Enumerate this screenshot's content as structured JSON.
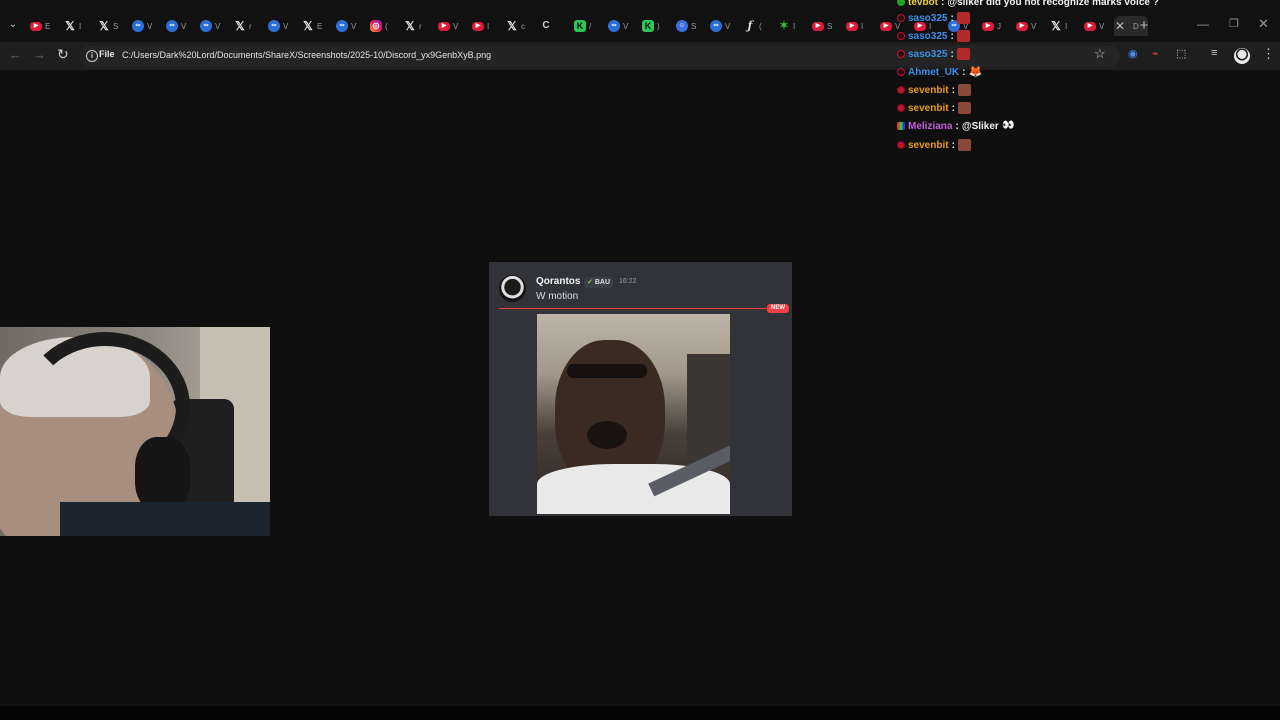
{
  "browser": {
    "tabs": [
      {
        "icon": "youtube-icon",
        "glyph": "▶",
        "kind": "yt",
        "label": "E"
      },
      {
        "icon": "x-icon",
        "glyph": "𝕏",
        "kind": "x",
        "label": "I"
      },
      {
        "icon": "x-icon",
        "glyph": "𝕏",
        "kind": "x",
        "label": "S"
      },
      {
        "icon": "copilot-icon",
        "glyph": "∞",
        "kind": "cp",
        "label": "V"
      },
      {
        "icon": "copilot-icon",
        "glyph": "∞",
        "kind": "cp",
        "label": "V"
      },
      {
        "icon": "copilot-icon",
        "glyph": "∞",
        "kind": "cp",
        "label": "V"
      },
      {
        "icon": "x-icon",
        "glyph": "𝕏",
        "kind": "x",
        "label": "r"
      },
      {
        "icon": "copilot-icon",
        "glyph": "∞",
        "kind": "cp",
        "label": "V"
      },
      {
        "icon": "x-icon",
        "glyph": "𝕏",
        "kind": "x",
        "label": "E"
      },
      {
        "icon": "copilot-icon",
        "glyph": "∞",
        "kind": "cp",
        "label": "V"
      },
      {
        "icon": "instagram-icon",
        "glyph": "◎",
        "kind": "ig",
        "label": "("
      },
      {
        "icon": "x-icon",
        "glyph": "𝕏",
        "kind": "x",
        "label": "r"
      },
      {
        "icon": "youtube-icon",
        "glyph": "▶",
        "kind": "yt",
        "label": "V"
      },
      {
        "icon": "youtube-icon",
        "glyph": "▶",
        "kind": "yt",
        "label": "I"
      },
      {
        "icon": "x-icon",
        "glyph": "𝕏",
        "kind": "x",
        "label": "c"
      },
      {
        "icon": "chat-icon",
        "glyph": "C",
        "kind": "ct",
        "label": ""
      },
      {
        "icon": "kick-icon",
        "glyph": "K",
        "kind": "km",
        "label": "/"
      },
      {
        "icon": "copilot-icon",
        "glyph": "∞",
        "kind": "cp",
        "label": "V"
      },
      {
        "icon": "kick-icon",
        "glyph": "K",
        "kind": "km",
        "label": ")"
      },
      {
        "icon": "discord-icon",
        "glyph": "☺",
        "kind": "dc",
        "label": "S"
      },
      {
        "icon": "copilot-icon",
        "glyph": "∞",
        "kind": "cp",
        "label": "V"
      },
      {
        "icon": "function-icon",
        "glyph": "ƒ",
        "kind": "fx",
        "label": "("
      },
      {
        "icon": "leaf-icon",
        "glyph": "✶",
        "kind": "gr",
        "label": "I"
      },
      {
        "icon": "youtube-icon",
        "glyph": "▶",
        "kind": "yt",
        "label": "S"
      },
      {
        "icon": "youtube-icon",
        "glyph": "▶",
        "kind": "yt",
        "label": "I"
      },
      {
        "icon": "youtube-icon",
        "glyph": "▶",
        "kind": "yt",
        "label": "V"
      },
      {
        "icon": "youtube-icon",
        "glyph": "▶",
        "kind": "yt",
        "label": "I"
      },
      {
        "icon": "copilot-icon",
        "glyph": "∞",
        "kind": "cp",
        "label": "V"
      },
      {
        "icon": "youtube-icon",
        "glyph": "▶",
        "kind": "yt",
        "label": "J"
      },
      {
        "icon": "youtube-icon",
        "glyph": "▶",
        "kind": "yt",
        "label": "V"
      },
      {
        "icon": "x-icon",
        "glyph": "𝕏",
        "kind": "x",
        "label": "I"
      },
      {
        "icon": "youtube-icon",
        "glyph": "▶",
        "kind": "yt",
        "label": "V"
      },
      {
        "icon": "document-icon",
        "glyph": "",
        "kind": "ct",
        "label": "D",
        "active": true
      }
    ],
    "tab_close_glyph": "✕",
    "new_tab_glyph": "+",
    "window_controls": {
      "minimize": "—",
      "maximize": "❐",
      "close": "✕"
    },
    "nav": {
      "back": "←",
      "forward": "→",
      "reload": "↻"
    },
    "address": {
      "chip": "File",
      "url": "C:/Users/Dark%20Lord/Documents/ShareX/Screenshots/2025-10/Discord_yx9GenbXyB.png"
    },
    "toolbar_icons": {
      "bookmark": "☆",
      "cast": "◉",
      "extension_a": "⌁",
      "extensions": "⬚",
      "reading_list": "≡",
      "menu": "⋮"
    }
  },
  "chat": {
    "lines": [
      {
        "badge": "green",
        "user": "tevbot",
        "user_color": "yellow",
        "text": "@sliker did you not recognize marks voice ?",
        "emote": ""
      },
      {
        "badge": "dark",
        "user": "saso325",
        "user_color": "blue",
        "text": "",
        "emote": "redface"
      },
      {
        "badge": "dark",
        "user": "saso325",
        "user_color": "blue",
        "text": "",
        "emote": "redface"
      },
      {
        "badge": "dark",
        "user": "saso325",
        "user_color": "blue",
        "text": "",
        "emote": "redface"
      },
      {
        "badge": "dark",
        "user": "Ahmet_UK",
        "user_color": "blue",
        "text": "",
        "emote": "fox"
      },
      {
        "badge": "red",
        "user": "sevenbit",
        "user_color": "orange",
        "text": "",
        "emote": "photo"
      },
      {
        "badge": "red",
        "user": "sevenbit",
        "user_color": "orange",
        "text": "",
        "emote": "photo"
      },
      {
        "badge": "multi",
        "user": "Meliziana",
        "user_color": "purple",
        "text": "@Sliker",
        "emote": "eyes"
      },
      {
        "badge": "red",
        "user": "sevenbit",
        "user_color": "orange",
        "text": "",
        "emote": "photo"
      }
    ],
    "separator": ":"
  },
  "discord_message": {
    "author": "Qorantos",
    "tag": "BAU",
    "timestamp": "16:22",
    "text": "W motion",
    "new_label": "NEW",
    "divider_color": "#f23f43"
  }
}
